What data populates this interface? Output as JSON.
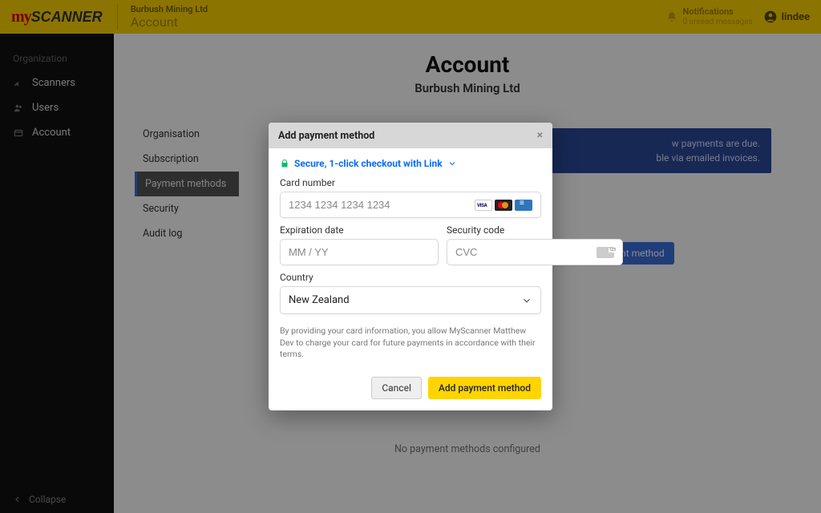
{
  "topbar": {
    "logo_prefix": "my",
    "logo_suffix": "SCANNER",
    "org_name": "Burbush Mining Ltd",
    "org_section": "Account",
    "notifications_title": "Notifications",
    "notifications_sub": "0 unread messages",
    "username": "lindee"
  },
  "sidebar": {
    "section_label": "Organization",
    "items": [
      {
        "label": "Scanners"
      },
      {
        "label": "Users"
      },
      {
        "label": "Account"
      }
    ],
    "collapse_label": "Collapse"
  },
  "page": {
    "title": "Account",
    "subtitle": "Burbush Mining Ltd",
    "tabs": [
      {
        "label": "Organisation"
      },
      {
        "label": "Subscription"
      },
      {
        "label": "Payment methods",
        "active": true
      },
      {
        "label": "Security"
      },
      {
        "label": "Audit log"
      }
    ],
    "banner_line1_suffix": "w payments are due.",
    "banner_line2_suffix": "ble via emailed invoices.",
    "add_button_bg": "Add payment method",
    "empty_state": "No payment methods configured"
  },
  "modal": {
    "title": "Add payment method",
    "secure_text": "Secure, 1-click checkout with Link",
    "card_label": "Card number",
    "card_placeholder": "1234 1234 1234 1234",
    "exp_label": "Expiration date",
    "exp_placeholder": "MM / YY",
    "cvc_label": "Security code",
    "cvc_placeholder": "CVC",
    "country_label": "Country",
    "country_value": "New Zealand",
    "disclaimer": "By providing your card information, you allow MyScanner Matthew Dev to charge your card for future payments in accordance with their terms.",
    "cancel_label": "Cancel",
    "submit_label": "Add payment method"
  }
}
